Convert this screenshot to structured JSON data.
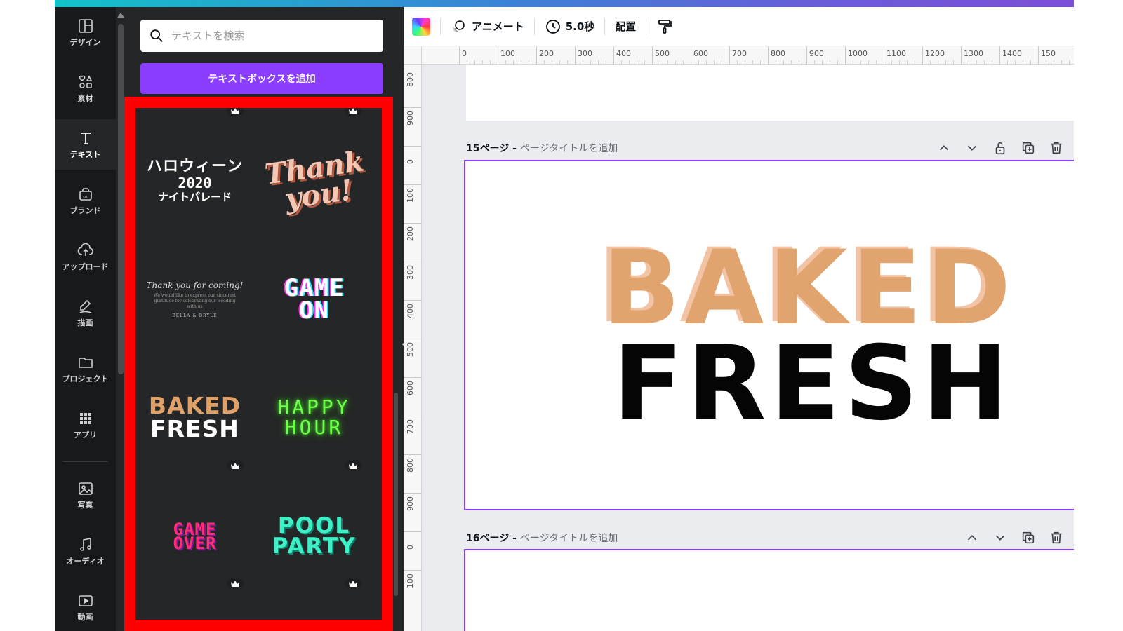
{
  "sidebar": {
    "items": [
      {
        "label": "デザイン",
        "icon": "layout-icon"
      },
      {
        "label": "素材",
        "icon": "elements-icon"
      },
      {
        "label": "テキスト",
        "icon": "text-icon"
      },
      {
        "label": "ブランド",
        "icon": "brand-icon"
      },
      {
        "label": "アップロード",
        "icon": "upload-icon"
      },
      {
        "label": "描画",
        "icon": "draw-icon"
      },
      {
        "label": "プロジェクト",
        "icon": "folder-icon"
      },
      {
        "label": "アプリ",
        "icon": "apps-icon"
      },
      {
        "label": "写真",
        "icon": "photo-icon"
      },
      {
        "label": "オーディオ",
        "icon": "audio-icon"
      },
      {
        "label": "動画",
        "icon": "video-icon"
      }
    ],
    "active_index": 2
  },
  "panel": {
    "search_placeholder": "テキストを検索",
    "add_button": "テキストボックスを追加",
    "templates": {
      "halloween": {
        "line1": "ハロウィーン",
        "line2": "2020",
        "line3": "ナイトパレード"
      },
      "thankyou": {
        "line1": "Thank",
        "line2": "you!"
      },
      "thanks_coming": {
        "line1": "Thank you for coming!",
        "line2": "We would like to express our sincerest gratitude for celebrating our wedding with us",
        "line3": "BELLA & BRYLE"
      },
      "gameon": {
        "line1": "GAME",
        "line2": "ON"
      },
      "baked": {
        "line1": "BAKED",
        "line2": "FRESH"
      },
      "happy": {
        "line1": "HAPPY",
        "line2": "HOUR"
      },
      "gameover": {
        "line1": "GAME",
        "line2": "OVER"
      },
      "pool": {
        "line1": "POOL",
        "line2": "PARTY"
      }
    }
  },
  "toolbar": {
    "animate": "アニメート",
    "duration": "5.0秒",
    "position": "配置"
  },
  "ruler": {
    "top": [
      "0",
      "100",
      "200",
      "300",
      "400",
      "500",
      "600",
      "700",
      "800",
      "900",
      "1000",
      "1100",
      "1200",
      "1300",
      "1400",
      "150"
    ],
    "left": [
      "800",
      "900",
      "0",
      "100",
      "200",
      "300",
      "400",
      "500",
      "600",
      "700",
      "800",
      "900",
      "0",
      "100"
    ]
  },
  "pages": {
    "p15": {
      "number": "15ページ",
      "separator": " - ",
      "title_placeholder": "ページタイトルを追加"
    },
    "p16": {
      "number": "16ページ",
      "separator": " - ",
      "title_placeholder": "ページタイトルを追加"
    }
  },
  "canvas": {
    "line1": "BAKED",
    "line2": "FRESH"
  },
  "colors": {
    "accent": "#8b3dff",
    "highlight": "#ff0000",
    "baked": "#e1a46f",
    "dark_panel": "#252627"
  }
}
